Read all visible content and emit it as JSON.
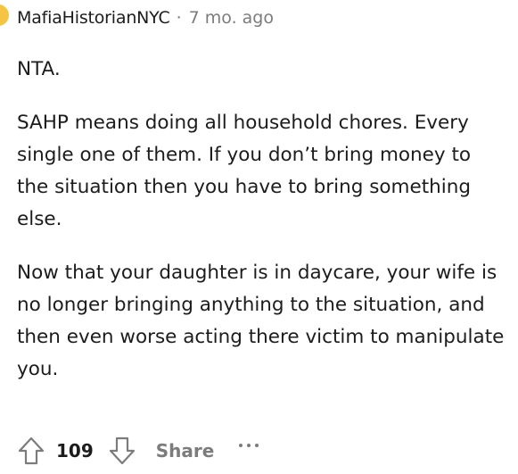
{
  "comment": {
    "author": "MafiaHistorianNYC",
    "separator": "·",
    "timestamp": "7 mo. ago",
    "paragraphs": [
      "NTA.",
      "SAHP means doing all household chores. Every single one of them. If you don’t bring money to the situation then you have to bring something else.",
      "Now that your daughter is in daycare, your wife is no longer bringing anything to the situation, and then even worse acting there victim to manipulate you."
    ]
  },
  "actions": {
    "upvote_icon": "upvote-arrow-icon",
    "score": "109",
    "downvote_icon": "downvote-arrow-icon",
    "share_label": "Share",
    "more_icon": "more-options-icon"
  },
  "colors": {
    "text": "#1c1c1c",
    "meta": "#7c7c7c",
    "avatar": "#f6c443"
  }
}
